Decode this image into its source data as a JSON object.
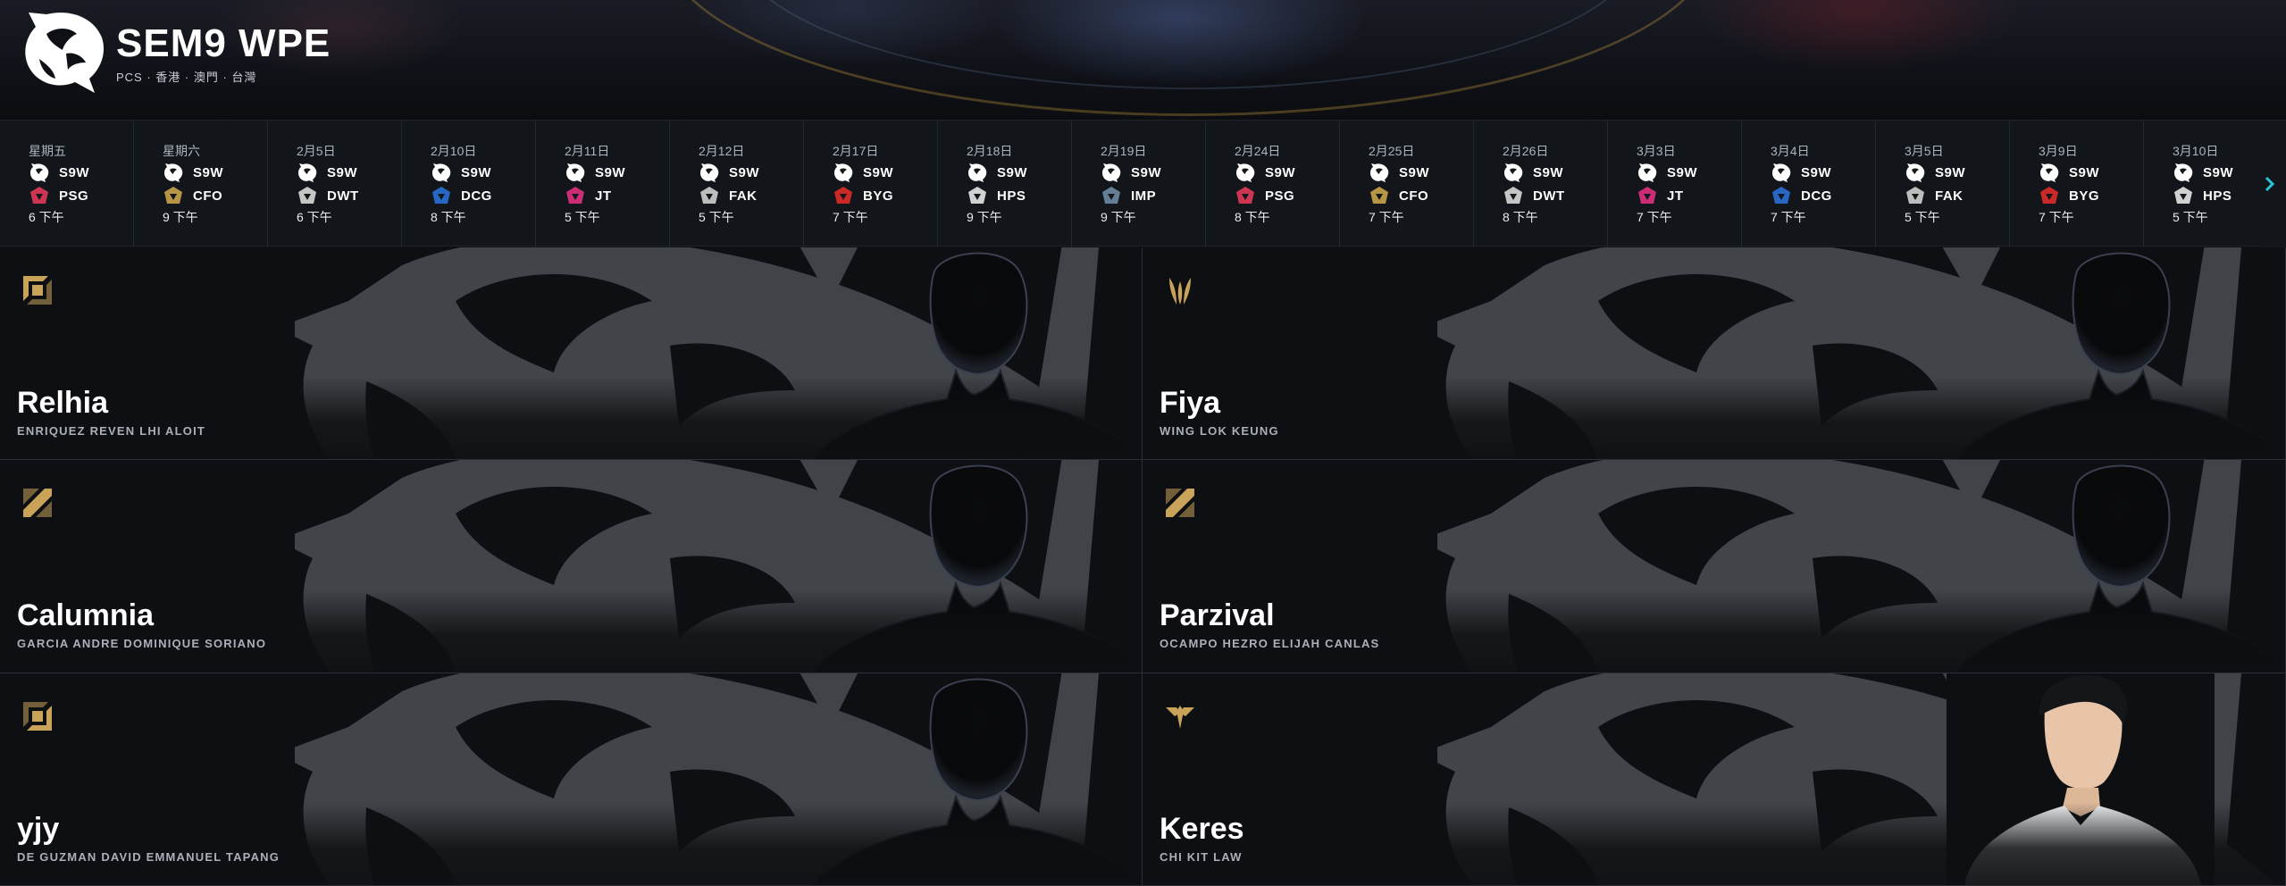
{
  "header": {
    "team_name": "SEM9 WPE",
    "league": "PCS · 香港 · 澳門 · 台灣"
  },
  "schedule": [
    {
      "date": "星期五",
      "team": "S9W",
      "opponent": "PSG",
      "time": "6 下午",
      "opp_color": "#e23a5a"
    },
    {
      "date": "星期六",
      "team": "S9W",
      "opponent": "CFO",
      "time": "9 下午",
      "opp_color": "#c9a44a"
    },
    {
      "date": "2月5日",
      "team": "S9W",
      "opponent": "DWT",
      "time": "6 下午",
      "opp_color": "#d8d8d8"
    },
    {
      "date": "2月10日",
      "team": "S9W",
      "opponent": "DCG",
      "time": "8 下午",
      "opp_color": "#2a6fd6"
    },
    {
      "date": "2月11日",
      "team": "S9W",
      "opponent": "JT",
      "time": "5 下午",
      "opp_color": "#e0317e"
    },
    {
      "date": "2月12日",
      "team": "S9W",
      "opponent": "FAK",
      "time": "5 下午",
      "opp_color": "#cfcfcf"
    },
    {
      "date": "2月17日",
      "team": "S9W",
      "opponent": "BYG",
      "time": "7 下午",
      "opp_color": "#e02a2a"
    },
    {
      "date": "2月18日",
      "team": "S9W",
      "opponent": "HPS",
      "time": "9 下午",
      "opp_color": "#e6e6e6"
    },
    {
      "date": "2月19日",
      "team": "S9W",
      "opponent": "IMP",
      "time": "9 下午",
      "opp_color": "#6f8aa3"
    },
    {
      "date": "2月24日",
      "team": "S9W",
      "opponent": "PSG",
      "time": "8 下午",
      "opp_color": "#e23a5a"
    },
    {
      "date": "2月25日",
      "team": "S9W",
      "opponent": "CFO",
      "time": "7 下午",
      "opp_color": "#c9a44a"
    },
    {
      "date": "2月26日",
      "team": "S9W",
      "opponent": "DWT",
      "time": "8 下午",
      "opp_color": "#d8d8d8"
    },
    {
      "date": "3月3日",
      "team": "S9W",
      "opponent": "JT",
      "time": "7 下午",
      "opp_color": "#e0317e"
    },
    {
      "date": "3月4日",
      "team": "S9W",
      "opponent": "DCG",
      "time": "7 下午",
      "opp_color": "#2a6fd6"
    },
    {
      "date": "3月5日",
      "team": "S9W",
      "opponent": "FAK",
      "time": "5 下午",
      "opp_color": "#cfcfcf"
    },
    {
      "date": "3月9日",
      "team": "S9W",
      "opponent": "BYG",
      "time": "7 下午",
      "opp_color": "#e02a2a"
    },
    {
      "date": "3月10日",
      "team": "S9W",
      "opponent": "HPS",
      "time": "5 下午",
      "opp_color": "#e6e6e6"
    }
  ],
  "players": [
    {
      "name": "Relhia",
      "real_name": "ENRIQUEZ REVEN LHI ALOIT",
      "role_icon": "top-lane-icon",
      "photo": false
    },
    {
      "name": "Fiya",
      "real_name": "WING LOK KEUNG",
      "role_icon": "jungle-icon",
      "photo": false
    },
    {
      "name": "Calumnia",
      "real_name": "GARCIA ANDRE DOMINIQUE SORIANO",
      "role_icon": "mid-lane-icon",
      "photo": false
    },
    {
      "name": "Parzival",
      "real_name": "OCAMPO HEZRO ELIJAH CANLAS",
      "role_icon": "mid-lane-icon",
      "photo": false
    },
    {
      "name": "yjy",
      "real_name": "DE GUZMAN DAVID EMMANUEL TAPANG",
      "role_icon": "bottom-lane-icon",
      "photo": false
    },
    {
      "name": "Keres",
      "real_name": "CHI KIT LAW",
      "role_icon": "support-icon",
      "photo": true
    }
  ],
  "colors": {
    "accent_gold": "#c9a35a",
    "background": "#0b0d10",
    "strip": "#121519",
    "next_arrow": "#27c2d6"
  }
}
